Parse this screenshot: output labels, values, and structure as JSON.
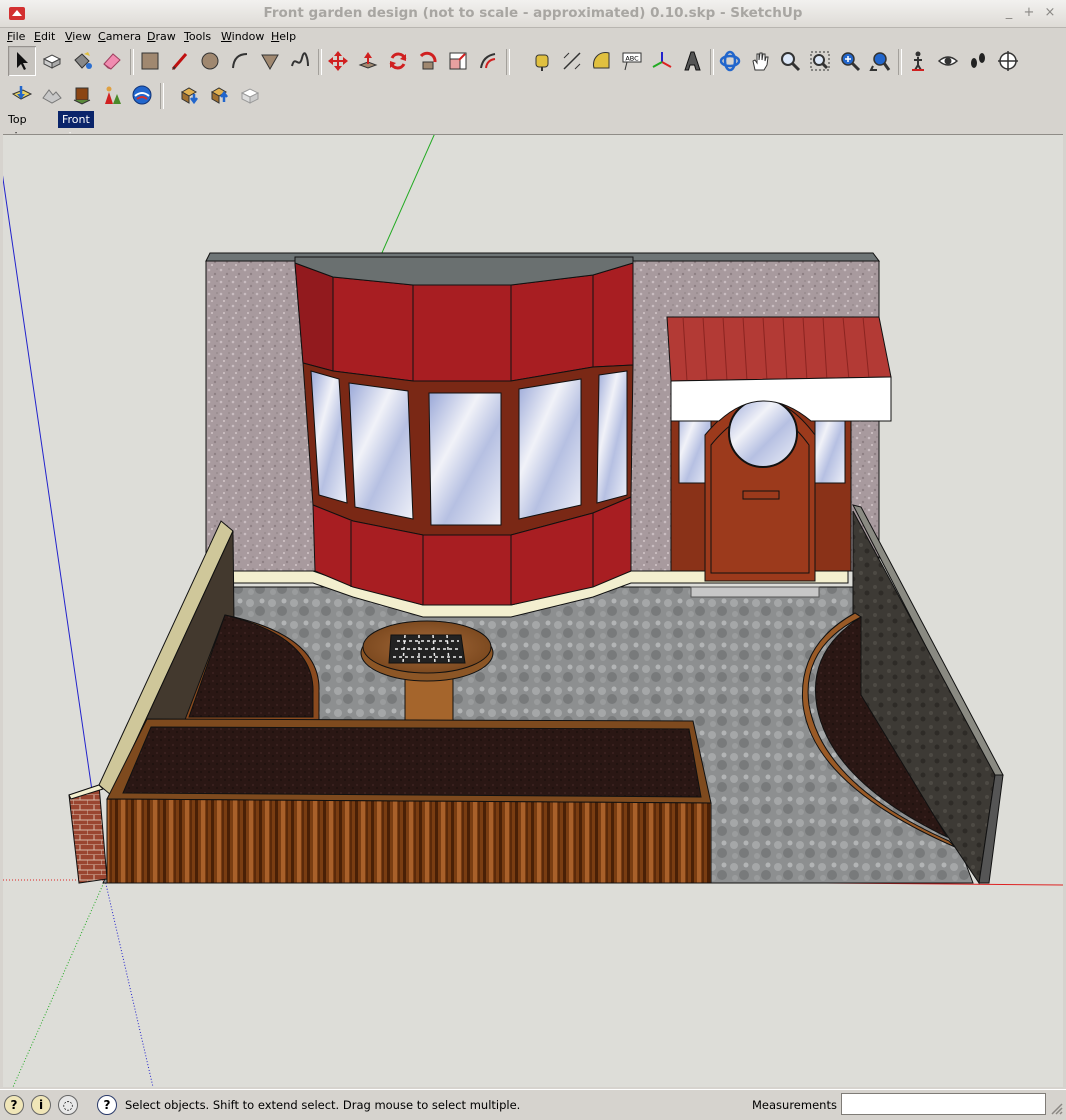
{
  "window": {
    "title": "Front garden design  (not to scale - approximated) 0.10.skp - SketchUp",
    "controls": [
      "_",
      "+",
      "×"
    ]
  },
  "menu": {
    "items": [
      "File",
      "Edit",
      "View",
      "Camera",
      "Draw",
      "Tools",
      "Window",
      "Help"
    ]
  },
  "toolbar": {
    "row1_icons": [
      "select-icon",
      "make-component-icon",
      "paint-bucket-icon",
      "eraser-icon",
      "rectangle-icon",
      "line-icon",
      "circle-icon",
      "arc-icon",
      "polygon-icon",
      "freehand-icon",
      "move-icon",
      "push-pull-icon",
      "rotate-icon",
      "follow-me-icon",
      "scale-icon",
      "offset-icon",
      "tape-measure-icon",
      "dimension-icon",
      "protractor-icon",
      "text-icon",
      "axes-icon",
      "3d-text-icon",
      "orbit-icon",
      "pan-icon",
      "zoom-icon",
      "zoom-window-icon",
      "zoom-extents-icon",
      "previous-view-icon",
      "position-camera-icon",
      "look-around-icon",
      "walk-icon",
      "section-plane-icon"
    ],
    "text_tool_label": "ABC",
    "row2_icons": [
      "get-current-view-icon",
      "toggle-terrain-icon",
      "add-location-icon",
      "photo-textures-icon",
      "google-earth-icon",
      "get-models-icon",
      "share-model-icon",
      "share-component-icon"
    ]
  },
  "scenes": {
    "tabs": [
      "Top view",
      "Front view"
    ],
    "active": "Front view"
  },
  "status": {
    "icons": [
      "geo-location-icon",
      "credits-icon",
      "user-login-icon",
      "help-icon"
    ],
    "message": "Select objects. Shift to extend select. Drag mouse to select multiple.",
    "measurements_label": "Measurements",
    "measurements_value": ""
  },
  "colors": {
    "viewport_bg": "#ddddd8",
    "active_tab": "#0a246a",
    "axis_red": "#dd2222",
    "axis_green": "#22aa22",
    "axis_blue": "#2222cc"
  }
}
